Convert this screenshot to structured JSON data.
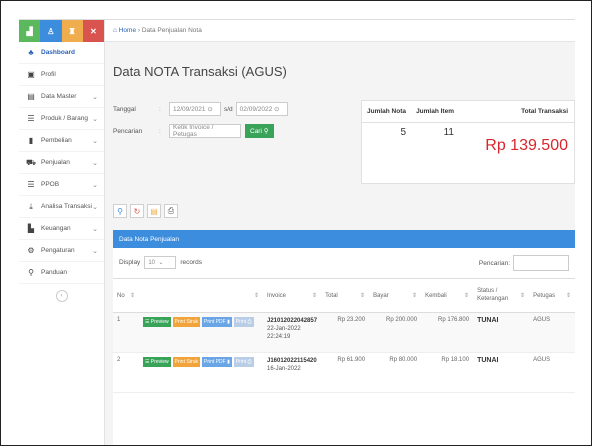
{
  "sidebar": {
    "items": [
      {
        "label": "Dashboard",
        "icon": "dashboard-icon",
        "active": true
      },
      {
        "label": "Profil",
        "icon": "profile-icon"
      },
      {
        "label": "Data Master",
        "icon": "database-icon",
        "chevron": true
      },
      {
        "label": "Produk / Barang",
        "icon": "list-icon",
        "chevron": true
      },
      {
        "label": "Pembelian",
        "icon": "shopping-bag-icon",
        "chevron": true
      },
      {
        "label": "Penjualan",
        "icon": "cart-icon",
        "chevron": true
      },
      {
        "label": "PPOB",
        "icon": "list-icon",
        "chevron": true
      },
      {
        "label": "Analisa Transaksi",
        "icon": "download-icon",
        "chevron": true
      },
      {
        "label": "Keuangan",
        "icon": "chart-icon",
        "chevron": true
      },
      {
        "label": "Pengaturan",
        "icon": "gears-icon",
        "chevron": true
      },
      {
        "label": "Panduan",
        "icon": "help-icon"
      }
    ],
    "top_colors": [
      "#5cb85c",
      "#3c8dde",
      "#f0ad4e",
      "#d9534f"
    ]
  },
  "breadcrumb": {
    "home": "Home",
    "current": "Data Penjualan Nota"
  },
  "page_title": "Data NOTA Transaksi (AGUS)",
  "filter": {
    "date_label": "Tanggal",
    "date_from": "12/09/2021",
    "sd": "s/d",
    "date_to": "02/09/2022",
    "search_label": "Pencarian",
    "search_placeholder": "Ketik Invoice / Petugas",
    "search_button": "Cari"
  },
  "summary": {
    "h_nota": "Jumlah Nota",
    "h_item": "Jumlah Item",
    "h_total": "Total Transaksi",
    "nota": "5",
    "item": "11",
    "total": "Rp 139.500"
  },
  "panel": {
    "title": "Data Nota Penjualan",
    "display": "Display",
    "display_value": "10",
    "records": "records",
    "search_label": "Pencarian:"
  },
  "table": {
    "headers": [
      "No",
      "",
      "Invoice",
      "Total",
      "Bayar",
      "Kembali",
      "Status / Keterangan",
      "Petugas"
    ],
    "actions": [
      "Preview",
      "Print Struk",
      "Print PDF",
      "Print"
    ],
    "rows": [
      {
        "no": "1",
        "invoice": "J21012022042857",
        "date": "22-Jan-2022",
        "time": "22:24:19",
        "total": "Rp 23.200",
        "bayar": "Rp 200.000",
        "kembali": "Rp 176.800",
        "status": "TUNAI",
        "petugas": "AGUS"
      },
      {
        "no": "2",
        "invoice": "J16012022115420",
        "date": "16-Jan-2022",
        "time": "",
        "total": "Rp 61.900",
        "bayar": "Rp 80.000",
        "kembali": "Rp 18.100",
        "status": "TUNAI",
        "petugas": "AGUS"
      }
    ]
  },
  "colors": {
    "accent": "#3c8dde",
    "total_red": "#d9262c",
    "green": "#3aa35a"
  }
}
